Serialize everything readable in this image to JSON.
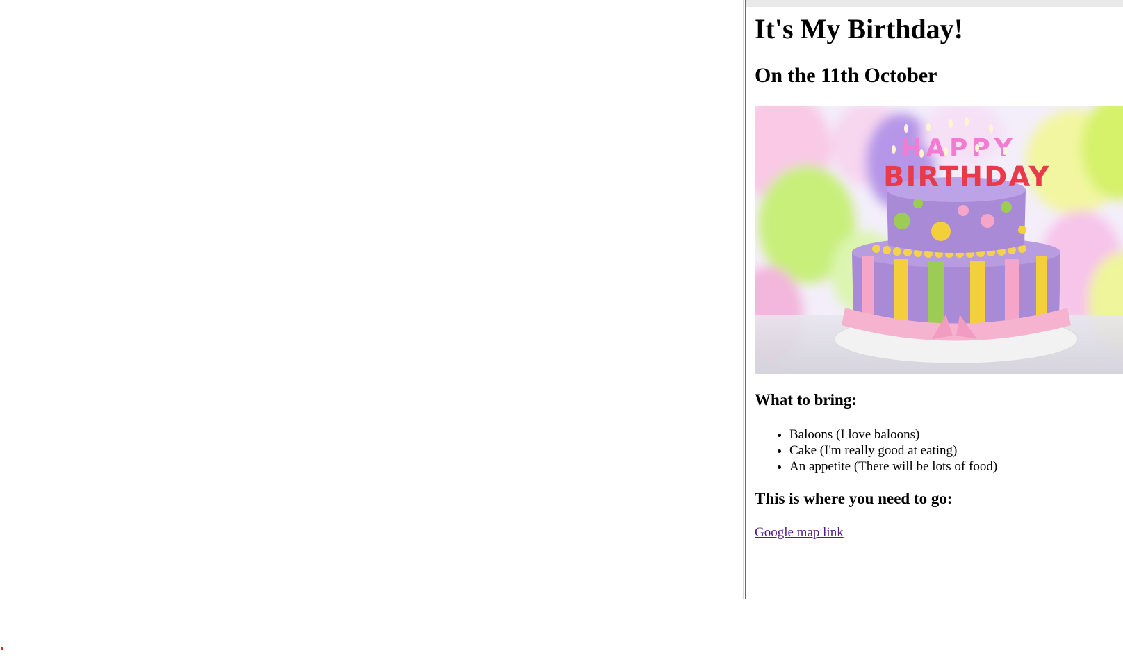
{
  "page": {
    "title": "It's My Birthday!",
    "subtitle": "On the 11th October",
    "image": {
      "icon": "birthday-cake-image",
      "candle_text_top": "HAPPY",
      "candle_text_bottom": "BIRTHDAY"
    },
    "bring_heading": "What to bring:",
    "bring_items": [
      "Baloons (I love baloons)",
      "Cake (I'm really good at eating)",
      "An appetite (There will be lots of food)"
    ],
    "go_heading": "This is where you need to go:",
    "map_link": "Google map link"
  },
  "colors": {
    "link_visited": "#551a8b",
    "cake_purple": "#a98ad6",
    "cake_pink": "#f5a6c8",
    "cake_yellow": "#f4cf3c",
    "cake_green": "#9ccc55"
  }
}
